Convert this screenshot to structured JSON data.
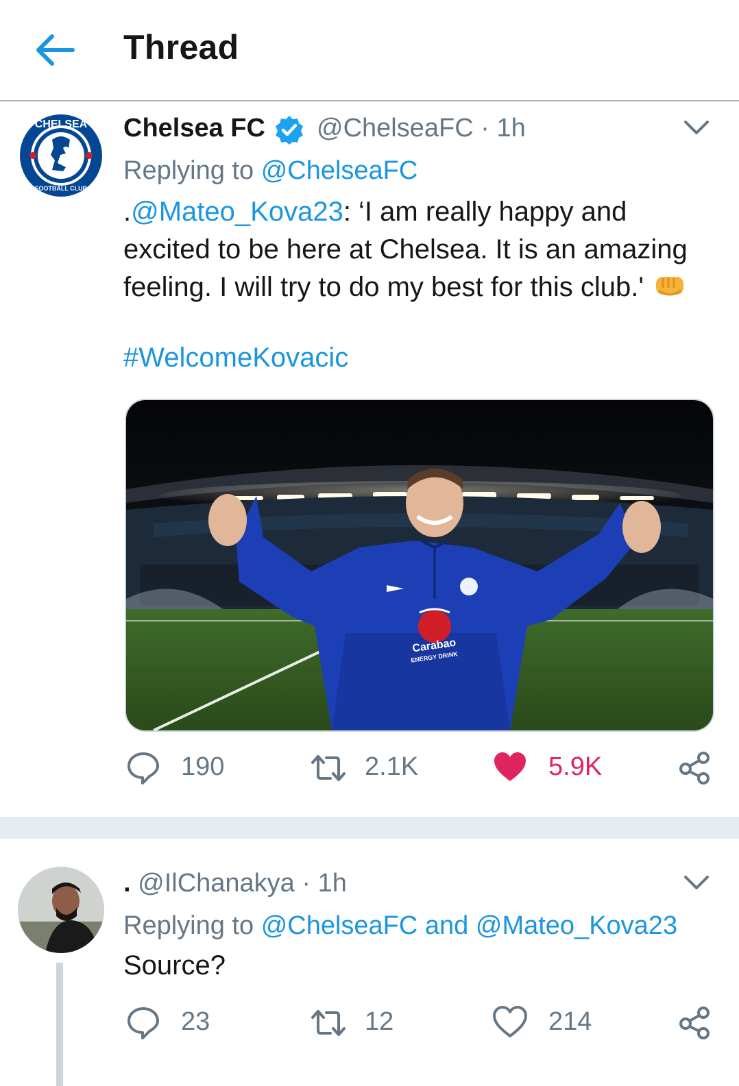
{
  "header": {
    "title": "Thread",
    "back_icon": "arrow-left-icon"
  },
  "tweet": {
    "author_name": "Chelsea FC",
    "verified_icon": "verified-badge-icon",
    "handle": "@ChelseaFC",
    "separator": "·",
    "time": "1h",
    "replying_prefix": "Replying to",
    "replying_to": "@ChelseaFC",
    "body_prefix": ".",
    "body_mention": "@Mateo_Kova23",
    "body_line1": ": ‘I am really happy and",
    "body_line2": "excited to be here at Chelsea. It is an amazing",
    "body_line3": "feeling. I will try to do my best for this club.'",
    "body_emoji": "👊",
    "hashtag": "#WelcomeKovacic",
    "media_text_1": "Carabao",
    "media_text_2": "ENERGY DRINK",
    "actions": {
      "replies": "190",
      "retweets": "2.1K",
      "likes": "5.9K",
      "liked": true
    }
  },
  "reply": {
    "display": ".",
    "handle": "@IlChanakya",
    "separator": "·",
    "time": "1h",
    "replying_prefix": "Replying to",
    "replying_to_1": "@ChelseaFC",
    "replying_and": "and",
    "replying_to_2": "@Mateo_Kova23",
    "body": "Source?",
    "actions": {
      "replies": "23",
      "retweets": "12",
      "likes": "214",
      "liked": false
    }
  },
  "colors": {
    "link": "#1b95e0",
    "like_active": "#e0245e",
    "muted": "#657786",
    "chelsea_blue": "#034694"
  }
}
